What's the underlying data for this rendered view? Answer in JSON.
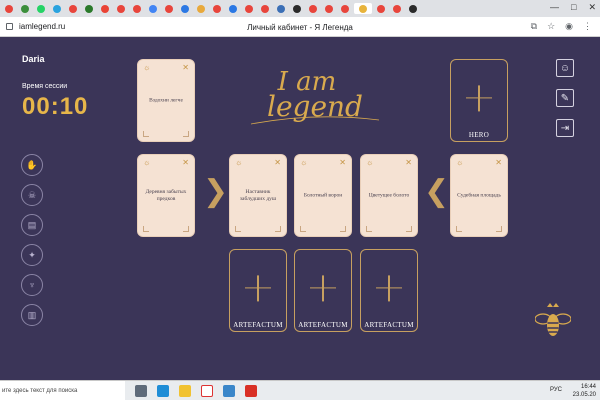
{
  "browser": {
    "url": "iamlegend.ru",
    "page_title": "Личный кабинет - Я Легенда",
    "tab_favicon_colors": [
      "#e8453c",
      "#3c8f3c",
      "#25d366",
      "#2aa3df",
      "#e8453c",
      "#2b7a2b",
      "#ea4335",
      "#e8453c",
      "#e8453c",
      "#4285f4",
      "#e8453c",
      "#2b78e4",
      "#e8a93c",
      "#e8453c",
      "#2b78e4",
      "#e8453c",
      "#e8453c",
      "#3b6fb6",
      "#2b2b2b",
      "#e8453c",
      "#e8453c",
      "#e8453c",
      "#e8b43c",
      "#e8453c",
      "#e8453c",
      "#2b2b2b"
    ],
    "window_controls": [
      "minimize-icon",
      "maximize-icon",
      "close-icon"
    ],
    "toolbar_icons": [
      "copy-icon",
      "star-icon",
      "profile-icon",
      "menu-icon"
    ]
  },
  "sidebar": {
    "user_name": "Daria",
    "session_label": "Время сессии",
    "session_time": "00:10",
    "icons": [
      "hands-icon",
      "skull-icon",
      "cards-icon",
      "book-icon",
      "cup-icon",
      "scroll-icon"
    ]
  },
  "right_toolbar": {
    "icons": [
      "user-card-icon",
      "edit-icon",
      "logout-icon"
    ]
  },
  "logo": {
    "line1": "I am",
    "line2": "legend"
  },
  "cards": {
    "top_left": "Вздохни легче",
    "row": [
      {
        "text": "Деревня забытых предков"
      },
      {
        "text": "Наставник заблудших душ"
      },
      {
        "text": "Болотный ворон"
      },
      {
        "text": "Цветущее болото"
      },
      {
        "text": "Судебная площадь"
      }
    ]
  },
  "slots": {
    "hero": "HERO",
    "artefacts": [
      "ARTEFACTUM",
      "ARTEFACTUM",
      "ARTEFACTUM"
    ]
  },
  "colors": {
    "background": "#3b3558",
    "accent_gold": "#c7a060",
    "timer": "#e7b64a",
    "card": "#f5e2d3"
  },
  "taskbar": {
    "search_placeholder": "ите здесь текст для поиска",
    "language": "РУС",
    "time": "16:44",
    "date": "23.05.20"
  }
}
